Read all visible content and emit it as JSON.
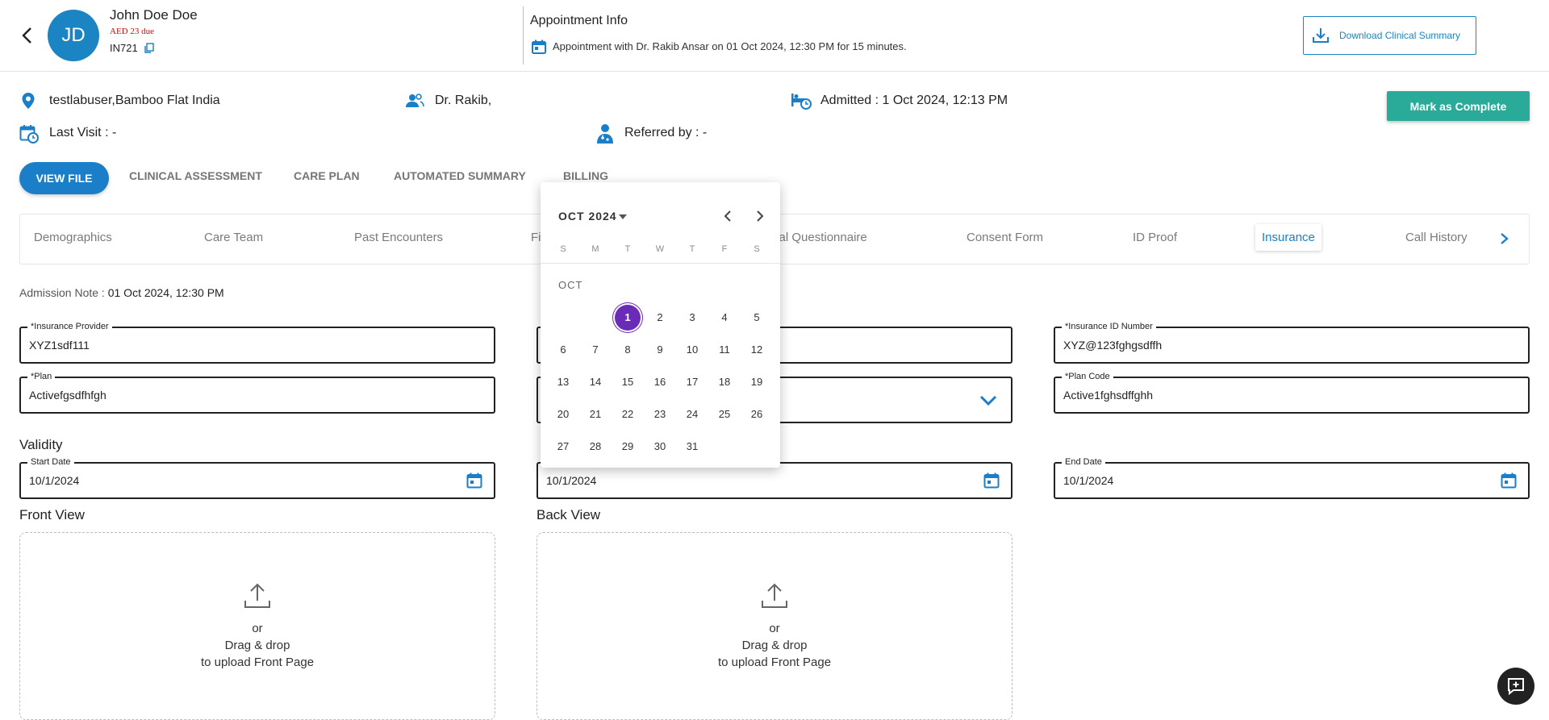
{
  "patient": {
    "initials": "JD",
    "name": "John Doe Doe",
    "due": "AED 23 due",
    "id": "IN721"
  },
  "appointment": {
    "title": "Appointment Info",
    "text": "Appointment with Dr. Rakib Ansar on 01 Oct 2024, 12:30 PM for 15 minutes."
  },
  "header_actions": {
    "download_label": "Download Clinical Summary"
  },
  "info": {
    "location": "testlabuser,Bamboo Flat India",
    "doctor": "Dr. Rakib,",
    "admitted": "Admitted : 1 Oct 2024, 12:13 PM",
    "last_visit": "Last Visit : -",
    "referred": "Referred by : -",
    "complete_label": "Mark as Complete"
  },
  "main_tabs": [
    "VIEW FILE",
    "CLINICAL ASSESSMENT",
    "CARE PLAN",
    "AUTOMATED SUMMARY",
    "BILLING"
  ],
  "sub_tabs": [
    "Demographics",
    "Care Team",
    "Past Encounters",
    "Fi",
    "cal Questionnaire",
    "Consent Form",
    "ID Proof",
    "Insurance",
    "Call History"
  ],
  "admission": {
    "label": "Admission Note :",
    "value": "01 Oct 2024, 12:30 PM"
  },
  "form": {
    "provider_label": "*Insurance Provider",
    "provider_value": "XYZ1sdf111",
    "id_label": "*Insurance ID Number",
    "id_value": "XYZ@123fghgsdffh",
    "plan_label": "*Plan",
    "plan_value": "Activefgsdfhfgh",
    "plan_code_label": "*Plan Code",
    "plan_code_value": "Active1fghsdffghh",
    "validity_label": "Validity",
    "start_label": "Start Date",
    "start_value": "10/1/2024",
    "middle_date_value": "10/1/2024",
    "end_label": "End Date",
    "end_value": "10/1/2024"
  },
  "uploads": {
    "front_title": "Front View",
    "back_title": "Back View",
    "or": "or",
    "drag": "Drag & drop",
    "hint": "to upload Front Page"
  },
  "calendar": {
    "month_label": "OCT 2024",
    "section_label": "OCT",
    "weekdays": [
      "S",
      "M",
      "T",
      "W",
      "T",
      "F",
      "S"
    ],
    "selected_day": 1
  },
  "colors": {
    "primary": "#1b7ec8",
    "accent_teal": "#2aab9a",
    "selected_day": "#6a2bb8",
    "due_red": "#e00000"
  }
}
